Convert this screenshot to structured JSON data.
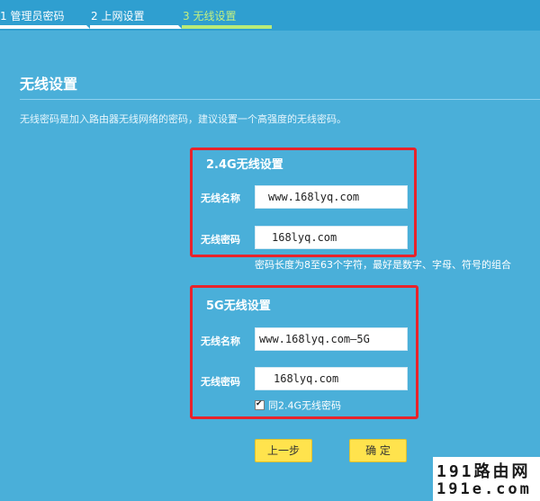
{
  "steps": [
    {
      "label": "1 管理员密码",
      "active": false
    },
    {
      "label": "2 上网设置",
      "active": false
    },
    {
      "label": "3 无线设置",
      "active": true
    }
  ],
  "section": {
    "title": "无线设置",
    "hint": "无线密码是加入路由器无线网络的密码，建议设置一个高强度的无线密码。"
  },
  "band_24": {
    "title": "2.4G无线设置",
    "ssid_label": "无线名称",
    "ssid_value": "www.168lyq.com",
    "password_label": "无线密码",
    "password_value": "168lyq.com"
  },
  "password_note": "密码长度为8至63个字符，最好是数字、字母、符号的组合",
  "band_5": {
    "title": "5G无线设置",
    "ssid_label": "无线名称",
    "ssid_value": "www.168lyq.com—5G",
    "password_label": "无线密码",
    "password_value": "168lyq.com",
    "same_password_checked": true,
    "same_password_label": "同2.4G无线密码"
  },
  "buttons": {
    "prev_label": "上一步",
    "confirm_label": "确 定"
  },
  "watermark": {
    "line1": "191路由网",
    "line2": "191e.com"
  },
  "colors": {
    "background": "#4aafd9",
    "highlight_border": "#e8232b",
    "button": "#ffe34d",
    "active_step": "#b9eb78"
  }
}
